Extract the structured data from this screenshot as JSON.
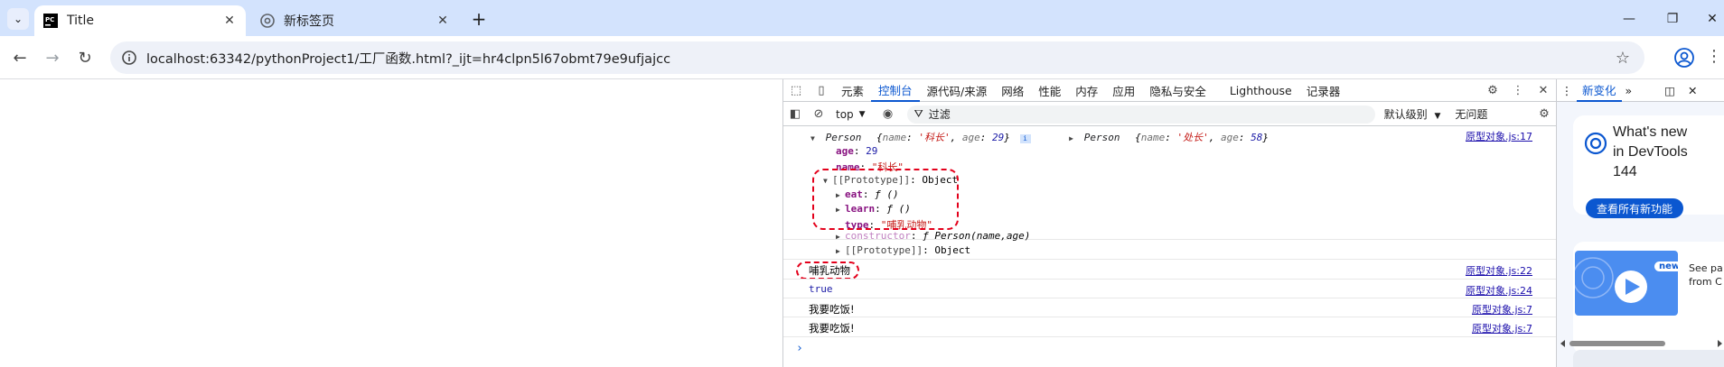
{
  "browser": {
    "tabs": [
      {
        "title": "Title",
        "active": true
      },
      {
        "title": "新标签页",
        "active": false
      }
    ],
    "url": "localhost:63342/pythonProject1/工厂函数.html?_ijt=hr4clpn5l67obmt79e9ufjajcc"
  },
  "devtools": {
    "tabs": [
      "元素",
      "控制台",
      "源代码/来源",
      "网络",
      "性能",
      "内存",
      "应用",
      "隐私与安全",
      "Lighthouse",
      "记录器"
    ],
    "selected_tab": "控制台",
    "context": "top",
    "filter_placeholder": "过滤",
    "levels": "默认级别",
    "issues": "无问题",
    "drawer": {
      "tab": "新变化",
      "title_line1": "What's new",
      "title_line2": "in DevTools",
      "title_line3": "144",
      "button": "查看所有新功能",
      "badge": "new",
      "side_line1": "See pa",
      "side_line2": "from C"
    },
    "console": {
      "obj1_type": "Person",
      "obj1_preview_name_key": "name",
      "obj1_preview_name": "'科长'",
      "obj1_preview_age_key": "age",
      "obj1_preview_age": "29",
      "obj2_type": "Person",
      "obj2_preview_name": "'处长'",
      "obj2_preview_age": "58",
      "source1": "原型对象.js:17",
      "prop_age_key": "age",
      "prop_age_val": "29",
      "prop_name_key": "name",
      "prop_name_val": "\"科长\"",
      "proto_label": "[[Prototype]]",
      "proto_value": "Object",
      "eat_key": "eat",
      "eat_val": "ƒ ()",
      "learn_key": "learn",
      "learn_val": "ƒ ()",
      "type_key": "type",
      "type_val": "\"哺乳动物\"",
      "constructor_key": "constructor",
      "constructor_val": "ƒ Person(name,age)",
      "proto2_label": "[[Prototype]]",
      "proto2_value": "Object",
      "log1": "哺乳动物",
      "log1_src": "原型对象.js:22",
      "log2": "true",
      "log2_src": "原型对象.js:24",
      "log3": "我要吃饭!",
      "log3_src": "原型对象.js:7",
      "log4": "我要吃饭!",
      "log4_src": "原型对象.js:7",
      "prompt": "›"
    }
  }
}
